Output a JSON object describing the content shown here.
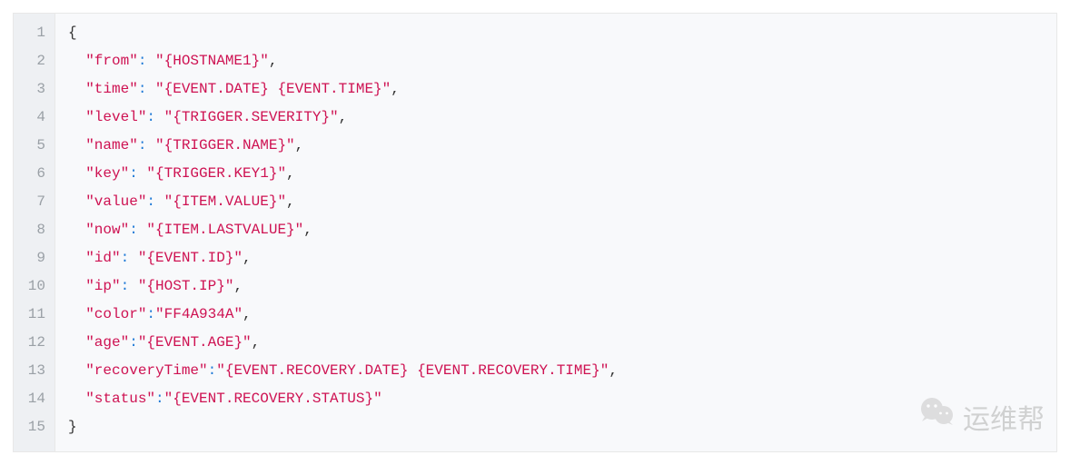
{
  "code": {
    "lines": [
      {
        "n": 1,
        "type": "brace",
        "text": "{"
      },
      {
        "n": 2,
        "type": "pair",
        "key": "\"from\"",
        "sep": ": ",
        "value": "\"{HOSTNAME1}\"",
        "comma": ","
      },
      {
        "n": 3,
        "type": "pair",
        "key": "\"time\"",
        "sep": ": ",
        "value": "\"{EVENT.DATE} {EVENT.TIME}\"",
        "comma": ","
      },
      {
        "n": 4,
        "type": "pair",
        "key": "\"level\"",
        "sep": ": ",
        "value": "\"{TRIGGER.SEVERITY}\"",
        "comma": ","
      },
      {
        "n": 5,
        "type": "pair",
        "key": "\"name\"",
        "sep": ": ",
        "value": "\"{TRIGGER.NAME}\"",
        "comma": ","
      },
      {
        "n": 6,
        "type": "pair",
        "key": "\"key\"",
        "sep": ": ",
        "value": "\"{TRIGGER.KEY1}\"",
        "comma": ","
      },
      {
        "n": 7,
        "type": "pair",
        "key": "\"value\"",
        "sep": ": ",
        "value": "\"{ITEM.VALUE}\"",
        "comma": ","
      },
      {
        "n": 8,
        "type": "pair",
        "key": "\"now\"",
        "sep": ": ",
        "value": "\"{ITEM.LASTVALUE}\"",
        "comma": ","
      },
      {
        "n": 9,
        "type": "pair",
        "key": "\"id\"",
        "sep": ": ",
        "value": "\"{EVENT.ID}\"",
        "comma": ","
      },
      {
        "n": 10,
        "type": "pair",
        "key": "\"ip\"",
        "sep": ": ",
        "value": "\"{HOST.IP}\"",
        "comma": ","
      },
      {
        "n": 11,
        "type": "pair",
        "key": "\"color\"",
        "sep": ":",
        "value": "\"FF4A934A\"",
        "comma": ","
      },
      {
        "n": 12,
        "type": "pair",
        "key": "\"age\"",
        "sep": ":",
        "value": "\"{EVENT.AGE}\"",
        "comma": ","
      },
      {
        "n": 13,
        "type": "pair",
        "key": "\"recoveryTime\"",
        "sep": ":",
        "value": "\"{EVENT.RECOVERY.DATE} {EVENT.RECOVERY.TIME}\"",
        "comma": ","
      },
      {
        "n": 14,
        "type": "pair",
        "key": "\"status\"",
        "sep": ":",
        "value": "\"{EVENT.RECOVERY.STATUS}\"",
        "comma": ""
      },
      {
        "n": 15,
        "type": "brace",
        "text": "}"
      }
    ]
  },
  "watermark": {
    "text": "运维帮"
  }
}
